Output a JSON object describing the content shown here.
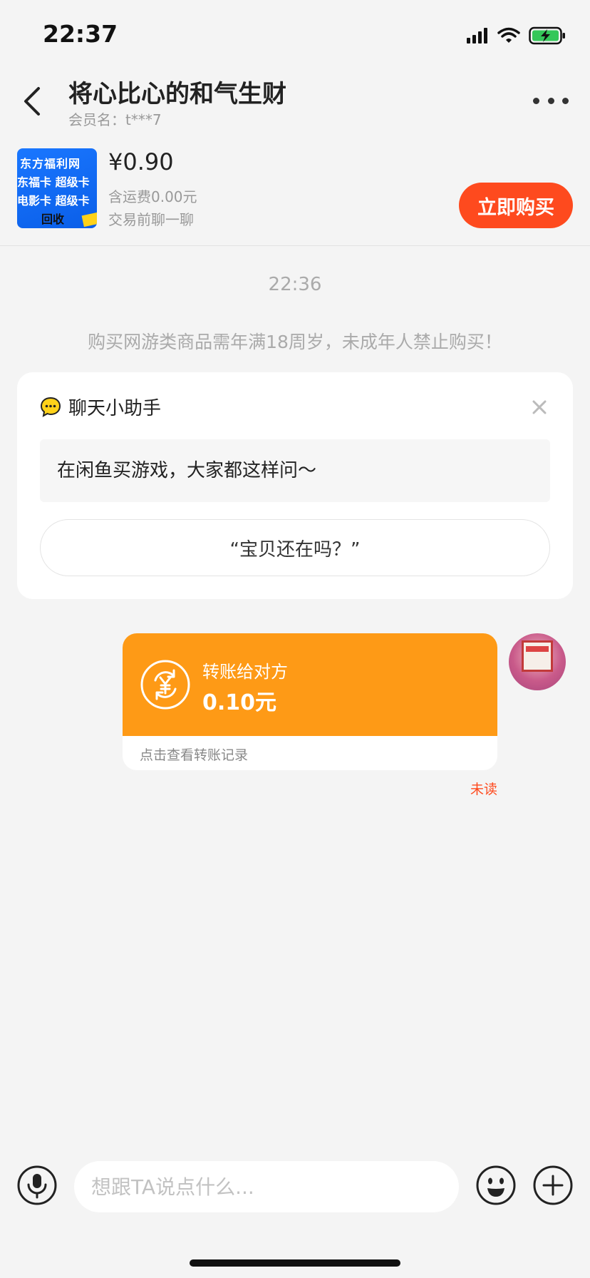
{
  "status_bar": {
    "time": "22:37",
    "icons": [
      "signal-icon",
      "wifi-icon",
      "battery-charging-icon"
    ]
  },
  "header": {
    "title": "将心比心的和气生财",
    "subtitle": "会员名：t***7"
  },
  "product": {
    "thumb_lines": [
      "东方福利网",
      "东福卡 超级卡",
      "电影卡 超级卡",
      "回收"
    ],
    "price": "¥0.90",
    "shipping": "含运费0.00元",
    "note": "交易前聊一聊",
    "buy_label": "立即购买"
  },
  "chat": {
    "time": "22:36",
    "notice": "购买网游类商品需年满18周岁，未成年人禁止购买！",
    "assistant": {
      "title": "聊天小助手",
      "prompt": "在闲鱼买游戏，大家都这样问～",
      "suggestion": "“宝贝还在吗？”"
    },
    "transfer": {
      "label": "转账给对方",
      "amount": "0.10元",
      "link": "点击查看转账记录",
      "status": "未读"
    }
  },
  "input": {
    "placeholder": "想跟TA说点什么..."
  },
  "colors": {
    "accent": "#fe4a1e",
    "transfer": "#fe9a16",
    "background": "#f4f4f4"
  }
}
